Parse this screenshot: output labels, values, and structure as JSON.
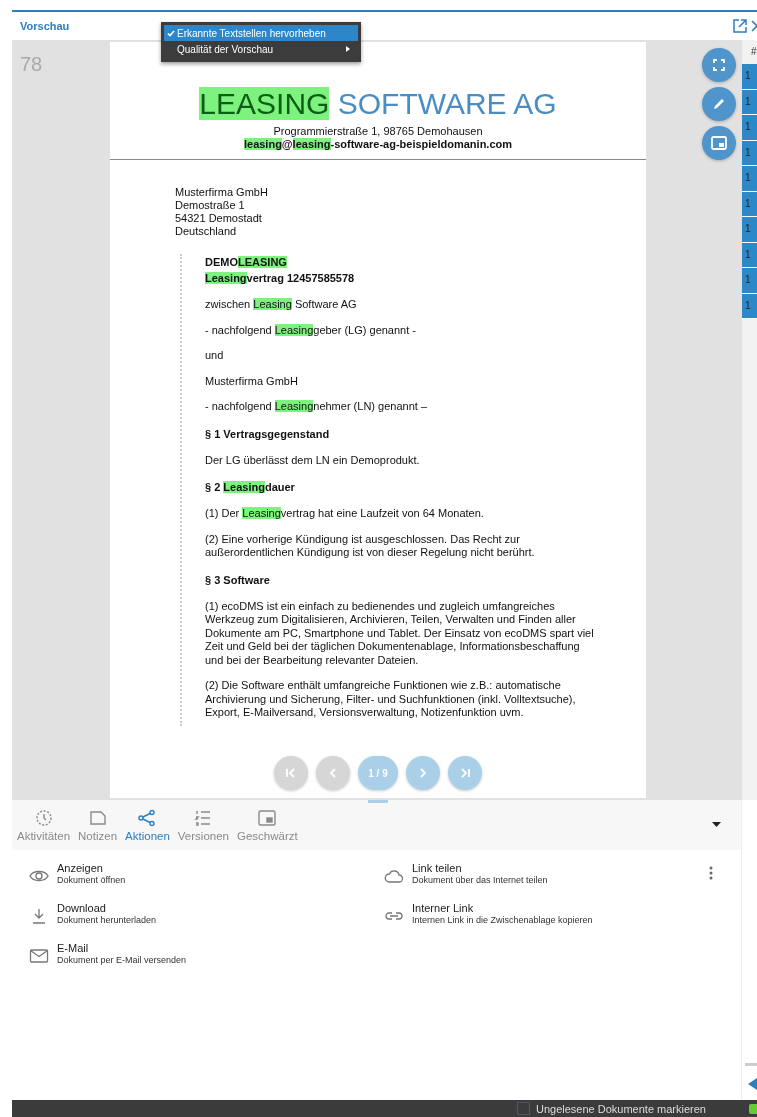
{
  "panel": {
    "title": "Vorschau"
  },
  "context_menu": [
    {
      "label": "Erkannte Textstellen hervorheben",
      "checked": true,
      "selected": true,
      "submenu": false
    },
    {
      "label": "Qualität der Vorschau",
      "checked": false,
      "selected": false,
      "submenu": true
    }
  ],
  "preview": {
    "page_number": "78",
    "letterhead": [
      {
        "text": "LEASING",
        "highlighted": true
      },
      {
        "text": " SOFTWARE AG",
        "highlighted": false
      }
    ],
    "address": [
      {
        "text": "Programmierstraße 1, 98765 Demohausen",
        "highlighted": false
      }
    ],
    "email": [
      {
        "text": "leasing",
        "highlighted": true
      },
      {
        "text": "@",
        "highlighted": false
      },
      {
        "text": "leasing",
        "highlighted": true
      },
      {
        "text": "-software-ag-beispieldomanin.com",
        "highlighted": false
      }
    ],
    "recipient": [
      "Musterfirma GmbH",
      "Demostraße 1",
      "54321 Demostadt",
      "Deutschland"
    ],
    "body": [
      {
        "kind": "heading",
        "lines": [
          [
            {
              "text": "DEMO",
              "highlighted": false
            },
            {
              "text": "LEASING",
              "highlighted": true
            }
          ],
          [
            {
              "text": "Leasing",
              "highlighted": true
            },
            {
              "text": "vertrag 12457585578",
              "highlighted": false
            }
          ]
        ]
      },
      {
        "kind": "text",
        "lines": [
          [
            {
              "text": "zwischen ",
              "highlighted": false
            },
            {
              "text": "Leasing",
              "highlighted": true
            },
            {
              "text": " Software AG",
              "highlighted": false
            }
          ]
        ]
      },
      {
        "kind": "text",
        "lines": [
          [
            {
              "text": "- nachfolgend ",
              "highlighted": false
            },
            {
              "text": "Leasing",
              "highlighted": true
            },
            {
              "text": "geber (LG) genannt -",
              "highlighted": false
            }
          ]
        ]
      },
      {
        "kind": "text",
        "lines": [
          [
            {
              "text": "und",
              "highlighted": false
            }
          ]
        ]
      },
      {
        "kind": "text",
        "lines": [
          [
            {
              "text": "Musterfirma GmbH",
              "highlighted": false
            }
          ]
        ]
      },
      {
        "kind": "text",
        "lines": [
          [
            {
              "text": "- nachfolgend ",
              "highlighted": false
            },
            {
              "text": "Leasing",
              "highlighted": true
            },
            {
              "text": "nehmer (LN) genannt –",
              "highlighted": false
            }
          ]
        ]
      },
      {
        "kind": "heading",
        "lines": [
          [
            {
              "text": "§ 1 Vertragsgegenstand",
              "highlighted": false
            }
          ]
        ]
      },
      {
        "kind": "text",
        "lines": [
          [
            {
              "text": "Der LG überlässt dem LN ein Demoprodukt.",
              "highlighted": false
            }
          ]
        ]
      },
      {
        "kind": "heading",
        "lines": [
          [
            {
              "text": "§ 2 ",
              "highlighted": false
            },
            {
              "text": "Leasing",
              "highlighted": true
            },
            {
              "text": "dauer",
              "highlighted": false
            }
          ]
        ]
      },
      {
        "kind": "text",
        "lines": [
          [
            {
              "text": "(1) Der ",
              "highlighted": false
            },
            {
              "text": "Leasing",
              "highlighted": true
            },
            {
              "text": "vertrag hat eine Laufzeit von 64 Monaten.",
              "highlighted": false
            }
          ]
        ]
      },
      {
        "kind": "text",
        "lines": [
          [
            {
              "text": "(2) Eine vorherige Kündigung ist ausgeschlossen. Das Recht zur",
              "highlighted": false
            }
          ],
          [
            {
              "text": "außerordentlichen Kündigung ist von dieser Regelung nicht berührt.",
              "highlighted": false
            }
          ]
        ]
      },
      {
        "kind": "heading",
        "lines": [
          [
            {
              "text": "§ 3 Software",
              "highlighted": false
            }
          ]
        ]
      },
      {
        "kind": "text",
        "lines": [
          [
            {
              "text": "(1) ecoDMS ist ein einfach zu bedienendes und zugleich umfangreiches",
              "highlighted": false
            }
          ],
          [
            {
              "text": "Werkzeug zum Digitalisieren, Archivieren, Teilen, Verwalten und Finden aller",
              "highlighted": false
            }
          ],
          [
            {
              "text": "Dokumente am PC, Smartphone und Tablet. Der Einsatz von ecoDMS spart viel",
              "highlighted": false
            }
          ],
          [
            {
              "text": "Zeit und Geld bei der täglichen Dokumentenablage, Informationsbeschaffung",
              "highlighted": false
            }
          ],
          [
            {
              "text": "und bei der Bearbeitung relevanter Dateien.",
              "highlighted": false
            }
          ]
        ]
      },
      {
        "kind": "text",
        "lines": [
          [
            {
              "text": "(2) Die Software enthält umfangreiche Funktionen wie z.B.: automatische",
              "highlighted": false
            }
          ],
          [
            {
              "text": "Archivierung und Sicherung, Filter- und Suchfunktionen (inkl. Volltextsuche),",
              "highlighted": false
            }
          ],
          [
            {
              "text": "Export, E-Mailversand, Versionsverwaltung, Notizenfunktion uvm.",
              "highlighted": false
            }
          ]
        ]
      }
    ],
    "pager": [
      {
        "kind": "first",
        "disabled": true
      },
      {
        "kind": "prev",
        "disabled": true
      },
      {
        "kind": "counter",
        "label": "1 / 9",
        "disabled": false
      },
      {
        "kind": "next",
        "disabled": false
      },
      {
        "kind": "last",
        "disabled": false
      }
    ]
  },
  "side_list": {
    "header": "#",
    "cells": [
      "1",
      "1",
      "1",
      "1",
      "1",
      "1",
      "1",
      "1",
      "1",
      "1"
    ]
  },
  "tabs": [
    {
      "label": "Aktivitäten",
      "kind": "activity",
      "selected": false
    },
    {
      "label": "Notizen",
      "kind": "notes",
      "selected": false
    },
    {
      "label": "Aktionen",
      "kind": "actions",
      "selected": true
    },
    {
      "label": "Versionen",
      "kind": "versions",
      "selected": false
    },
    {
      "label": "Geschwärzt",
      "kind": "redacted",
      "selected": false
    }
  ],
  "actions": [
    {
      "title": "Anzeigen",
      "subtitle": "Dokument öffnen",
      "kind": "view"
    },
    {
      "title": "Link teilen",
      "subtitle": "Dokument über das Internet teilen",
      "kind": "share"
    },
    {
      "title": "Download",
      "subtitle": "Dokument herunterladen",
      "kind": "download"
    },
    {
      "title": "Interner Link",
      "subtitle": "Internen Link in die Zwischenablage kopieren",
      "kind": "link"
    },
    {
      "title": "E-Mail",
      "subtitle": "Dokument per E-Mail versenden",
      "kind": "email"
    }
  ],
  "status_bar": {
    "checkbox_label": "Ungelesene Dokumente markieren",
    "checked": false
  }
}
